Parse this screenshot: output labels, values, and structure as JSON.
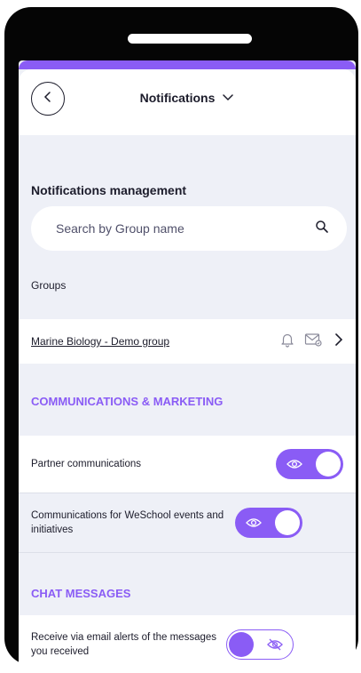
{
  "header": {
    "title": "Notifications"
  },
  "management": {
    "title": "Notifications management",
    "search_placeholder": "Search by Group name"
  },
  "groups": {
    "label": "Groups",
    "items": [
      {
        "name": "Marine Biology - Demo group"
      }
    ]
  },
  "communications": {
    "title": "COMMUNICATIONS & MARKETING",
    "items": [
      {
        "label": "Partner communications",
        "enabled": true
      },
      {
        "label": "Communications for WeSchool events and initiatives",
        "enabled": true
      }
    ]
  },
  "chat": {
    "title": "CHAT MESSAGES",
    "items": [
      {
        "label": "Receive via email alerts of the messages you received",
        "enabled": false
      }
    ]
  },
  "colors": {
    "accent": "#8a5cf5",
    "background": "#eef0f7",
    "text": "#1c1c2b"
  }
}
